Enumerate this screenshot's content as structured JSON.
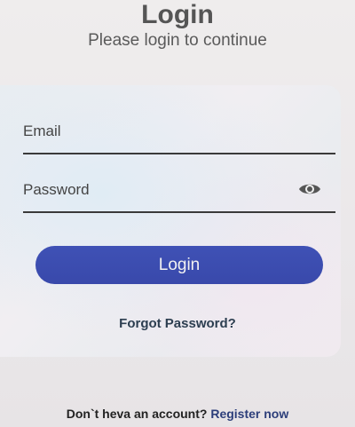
{
  "header": {
    "title": "Login",
    "subtitle": "Please login to continue"
  },
  "form": {
    "email_label": "Email",
    "password_label": "Password",
    "login_button": "Login",
    "forgot_link": "Forgot Password?",
    "password_toggle_icon": "eye-icon"
  },
  "footer": {
    "prompt": "Don`t heva an account?",
    "register_link": "Register now"
  },
  "colors": {
    "accent": "#3f51b5",
    "background": "#ebe8ea",
    "text": "#555555"
  }
}
